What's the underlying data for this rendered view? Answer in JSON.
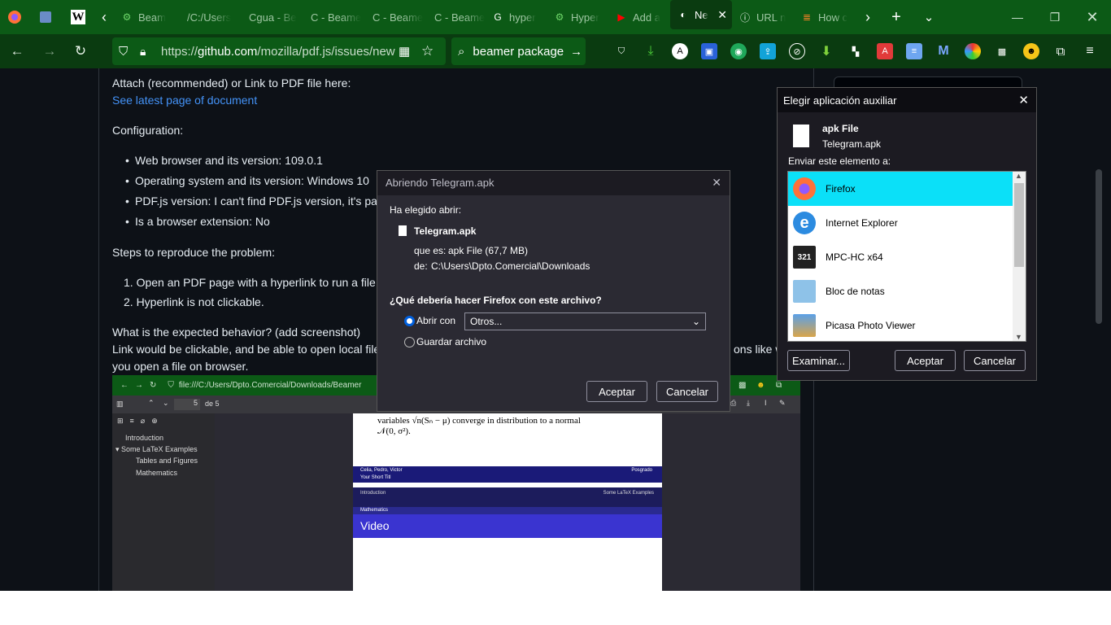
{
  "tabs": [
    {
      "label": "Beam",
      "icon": "gear-icon"
    },
    {
      "label": "/C:/Users",
      "icon": ""
    },
    {
      "label": "Cgua - Be",
      "icon": ""
    },
    {
      "label": "C - Beame",
      "icon": ""
    },
    {
      "label": "C - Beame",
      "icon": ""
    },
    {
      "label": "C - Beame",
      "icon": ""
    },
    {
      "label": "hyper",
      "icon": "google-icon"
    },
    {
      "label": "Hyper",
      "icon": "gear-icon"
    },
    {
      "label": "Add a",
      "icon": "youtube-icon"
    },
    {
      "label": "Ne",
      "icon": "github-icon"
    },
    {
      "label": "URL n",
      "icon": "info-icon"
    },
    {
      "label": "How c",
      "icon": "stack-icon"
    }
  ],
  "url": {
    "prefix": "https://",
    "domain": "github.com",
    "path": "/mozilla/pdf.js/issues/new"
  },
  "search": {
    "text": "beamer package"
  },
  "issue": {
    "attach": "Attach (recommended) or Link to PDF file here:",
    "see_latest": "See latest page of document",
    "configuration": "Configuration:",
    "bullets": [
      "Web browser and its version: 109.0.1",
      "Operating system and its version: Windows 10",
      "PDF.js version: I can't find PDF.js version, it's pack",
      "Is a browser extension: No"
    ],
    "steps_heading": "Steps to reproduce the problem:",
    "steps": [
      "1. Open an PDF page with a hyperlink to run a file.",
      "2. Hyperlink is not clickable."
    ],
    "expected_q": "What is the expected behavior? (add screenshot)",
    "expected_a1": "Link would be clickable, and be able to open local file t",
    "expected_a1b": "ons like wh",
    "expected_a2": "you open a file on browser."
  },
  "embed": {
    "url": "file:///C:/Users/Dpto.Comercial/Downloads/Beamer",
    "page": "5",
    "pages": "de 5",
    "outline": [
      "Introduction",
      "Some LaTeX Examples",
      "Tables and Figures",
      "Mathematics"
    ],
    "text1": "variables √n(Sₙ − μ) converge in distribution to a normal",
    "text2": "𝒩(0, σ²).",
    "authors": "Celia, Pedro, Victor",
    "institute": "Posgrado",
    "short_title": "Your Short Titl",
    "nav_intro": "Introduction",
    "nav_section": "Some LaTeX Examples",
    "subsection": "Mathematics",
    "frame_title": "Video"
  },
  "dialog_open": {
    "title": "Abriendo Telegram.apk",
    "chosen": "Ha elegido abrir:",
    "filename": "Telegram.apk",
    "type_label": "que es:",
    "type_value": "apk File (67,7 MB)",
    "from_label": "de:",
    "from_value": "C:\\Users\\Dpto.Comercial\\Downloads",
    "question": "¿Qué debería hacer Firefox con este archivo?",
    "open_with": "Abrir con",
    "app_select": "Otros...",
    "save_file": "Guardar archivo",
    "ok": "Aceptar",
    "cancel": "Cancelar"
  },
  "dialog_helper": {
    "title": "Elegir aplicación auxiliar",
    "file_type": "apk File",
    "file_name": "Telegram.apk",
    "send_to": "Enviar este elemento a:",
    "apps": [
      "Firefox",
      "Internet Explorer",
      "MPC-HC x64",
      "Bloc de notas",
      "Picasa Photo Viewer"
    ],
    "browse": "Examinar...",
    "ok": "Aceptar",
    "cancel": "Cancelar"
  }
}
